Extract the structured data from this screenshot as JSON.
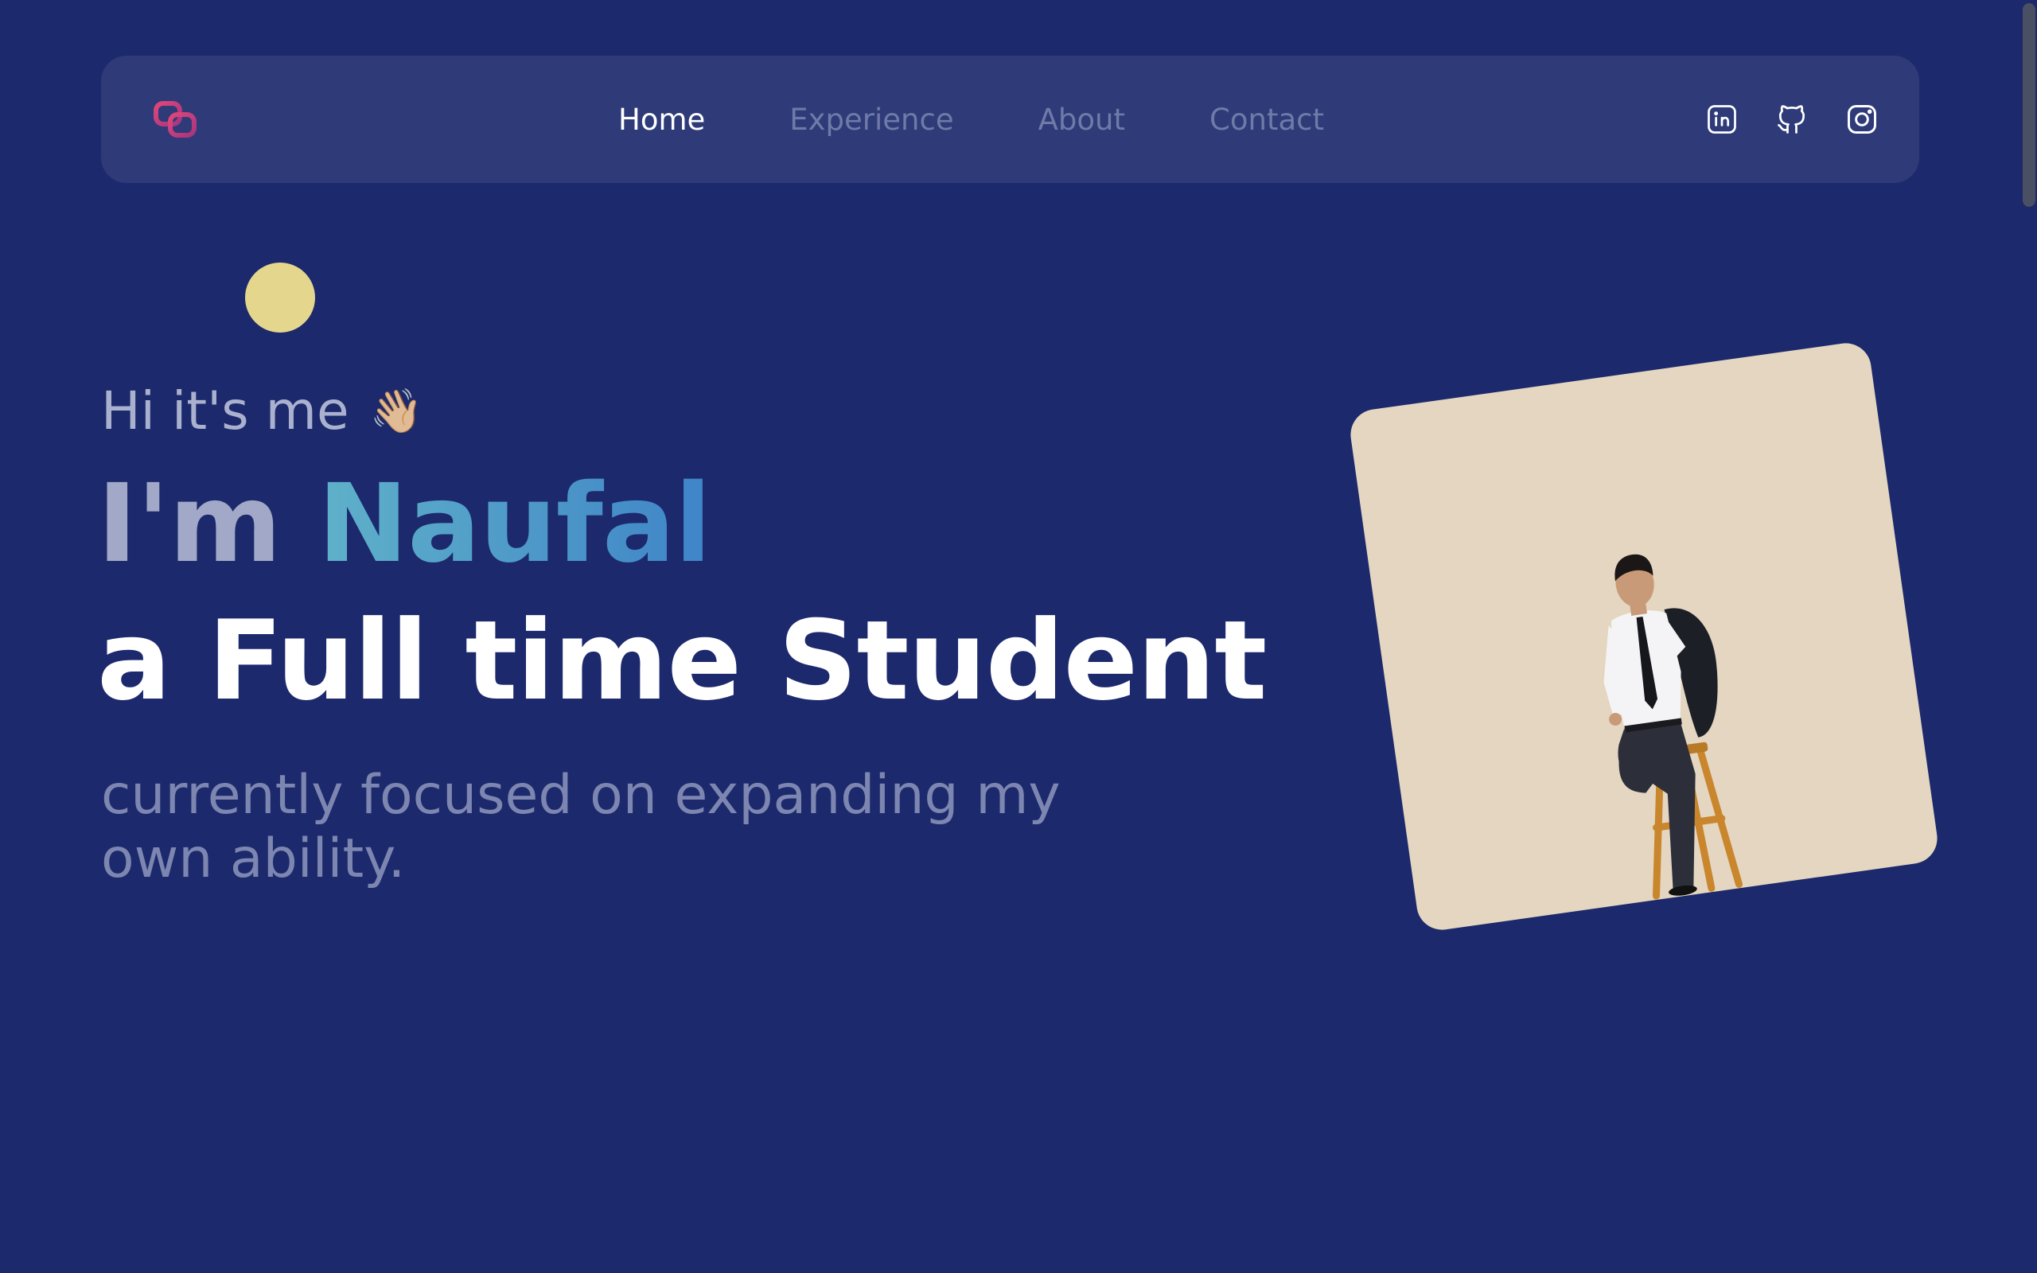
{
  "nav": {
    "logo_icon": "chain-link-logo",
    "links": [
      {
        "label": "Home",
        "active": true
      },
      {
        "label": "Experience",
        "active": false
      },
      {
        "label": "About",
        "active": false
      },
      {
        "label": "Contact",
        "active": false
      }
    ],
    "social": [
      {
        "icon": "linkedin-icon"
      },
      {
        "icon": "github-icon"
      },
      {
        "icon": "instagram-icon"
      }
    ]
  },
  "hero": {
    "greeting": "Hi it's me",
    "wave_emoji": "👋🏼",
    "im": "I'm",
    "name": "Naufal",
    "role": "a Full time Student",
    "tagline": "currently focused on expanding my own ability."
  },
  "colors": {
    "background": "#1c296c",
    "navbar": "#2e3b78",
    "accent_yellow": "#e4d68c",
    "name_gradient_start": "#5fb1c9",
    "name_gradient_end": "#3f84c8",
    "photo_background": "#e4d6c1"
  }
}
